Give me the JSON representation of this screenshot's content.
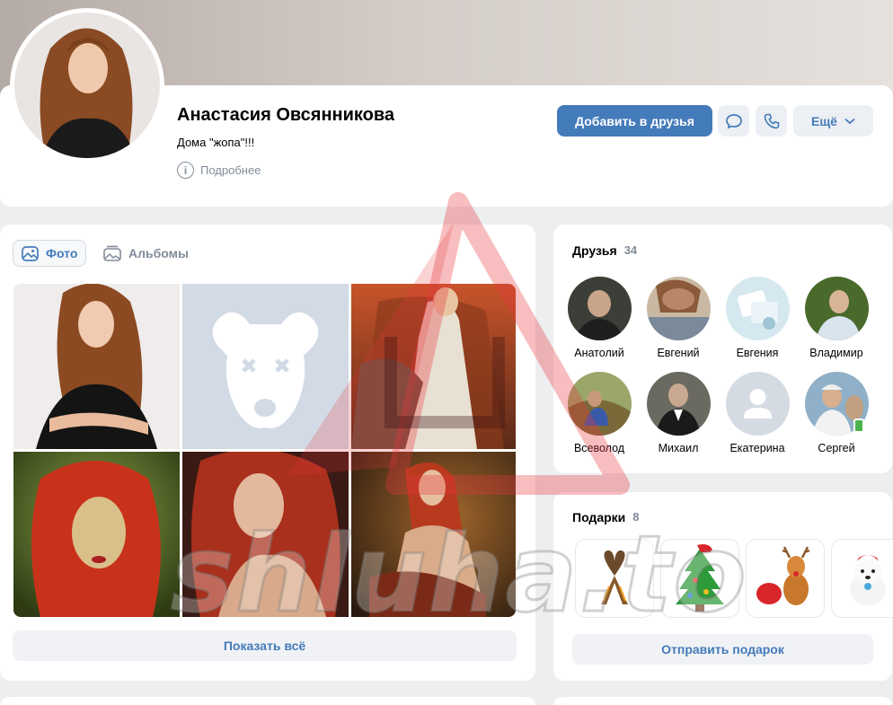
{
  "profile": {
    "name": "Анастасия Овсянникова",
    "status": "Дома \"жопа\"!!!",
    "more_info": "Подробнее"
  },
  "actions": {
    "add_friend": "Добавить в друзья",
    "more": "Ещё"
  },
  "photos": {
    "tabs": [
      "Фото",
      "Альбомы"
    ],
    "show_all": "Показать всё"
  },
  "friends": {
    "title": "Друзья",
    "count": "34",
    "items": [
      {
        "name": "Анатолий"
      },
      {
        "name": "Евгений"
      },
      {
        "name": "Евгения"
      },
      {
        "name": "Владимир"
      },
      {
        "name": "Всеволод"
      },
      {
        "name": "Михаил"
      },
      {
        "name": "Екатерина"
      },
      {
        "name": "Сергей"
      }
    ]
  },
  "gifts": {
    "title": "Подарки",
    "count": "8",
    "send": "Отправить подарок"
  },
  "watermark": {
    "text": "shluha.to"
  },
  "colors": {
    "accent": "#447bba",
    "page_bg": "#edeef0",
    "secondary_text": "#818c99",
    "watermark_red": "#e8383c"
  }
}
